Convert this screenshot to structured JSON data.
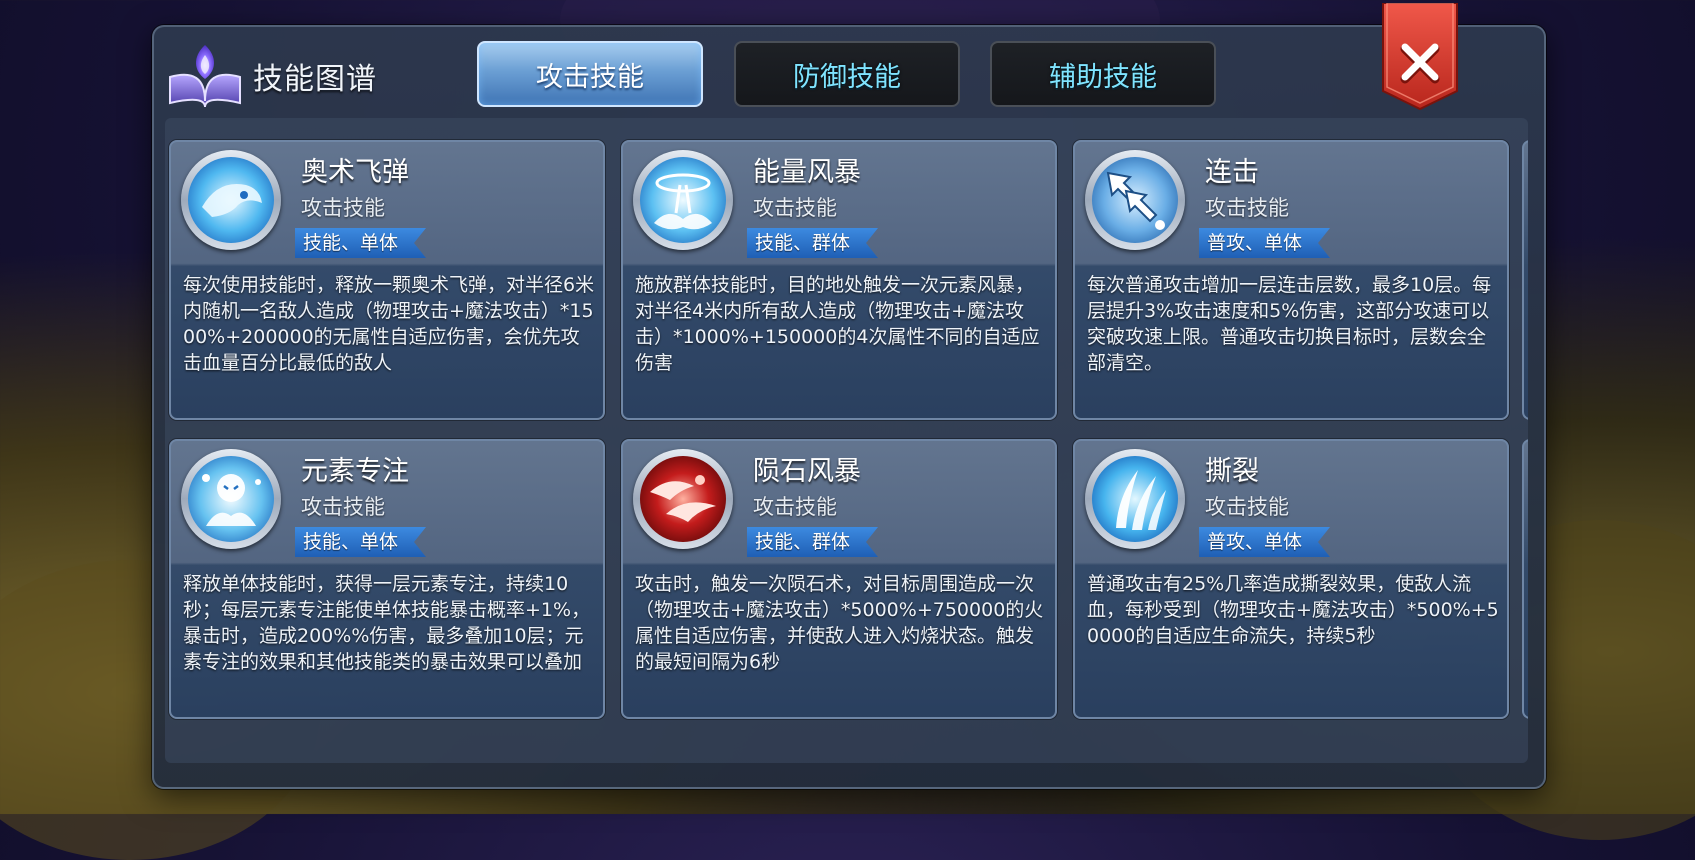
{
  "dialog": {
    "title": "技能图谱",
    "close_label": "×"
  },
  "tabs": [
    {
      "label": "攻击技能",
      "active": true
    },
    {
      "label": "防御技能",
      "active": false
    },
    {
      "label": "辅助技能",
      "active": false
    }
  ],
  "skills": [
    {
      "name": "奥术飞弹",
      "category": "攻击技能",
      "tag": "技能、单体",
      "icon": "arcane-missile-icon",
      "description": "每次使用技能时，释放一颗奥术飞弹，对半径6米内随机一名敌人造成（物理攻击+魔法攻击）*1500%+200000的无属性自适应伤害，会优先攻击血量百分比最低的敌人"
    },
    {
      "name": "能量风暴",
      "category": "攻击技能",
      "tag": "技能、群体",
      "icon": "energy-storm-icon",
      "description": "施放群体技能时，目的地处触发一次元素风暴，对半径4米内所有敌人造成（物理攻击+魔法攻击）*1000%+150000的4次属性不同的自适应伤害"
    },
    {
      "name": "连击",
      "category": "攻击技能",
      "tag": "普攻、单体",
      "icon": "combo-strike-icon",
      "description": "每次普通攻击增加一层连击层数，最多10层。每层提升3%攻击速度和5%伤害，这部分攻速可以突破攻速上限。普通攻击切换目标时，层数会全部清空。"
    },
    {
      "name": "元素专注",
      "category": "攻击技能",
      "tag": "技能、单体",
      "icon": "element-focus-icon",
      "description": "释放单体技能时，获得一层元素专注，持续10秒；每层元素专注能使单体技能暴击概率+1%，暴击时，造成200%%伤害，最多叠加10层；元素专注的效果和其他技能类的暴击效果可以叠加"
    },
    {
      "name": "陨石风暴",
      "category": "攻击技能",
      "tag": "技能、群体",
      "icon": "meteor-storm-icon",
      "description": "攻击时，触发一次陨石术，对目标周围造成一次（物理攻击+魔法攻击）*5000%+750000的火属性自适应伤害，并使敌人进入灼烧状态。触发的最短间隔为6秒"
    },
    {
      "name": "撕裂",
      "category": "攻击技能",
      "tag": "普攻、单体",
      "icon": "rend-icon",
      "description": "普通攻击有25%几率造成撕裂效果，使敌人流血，每秒受到（物理攻击+魔法攻击）*500%+50000的自适应生命流失，持续5秒"
    }
  ],
  "colors": {
    "tab_active": "#6b9fd4",
    "tab_text_inactive": "#7fe4ff",
    "tag_blue": "#2a6fc8",
    "close_red": "#d8372c"
  }
}
